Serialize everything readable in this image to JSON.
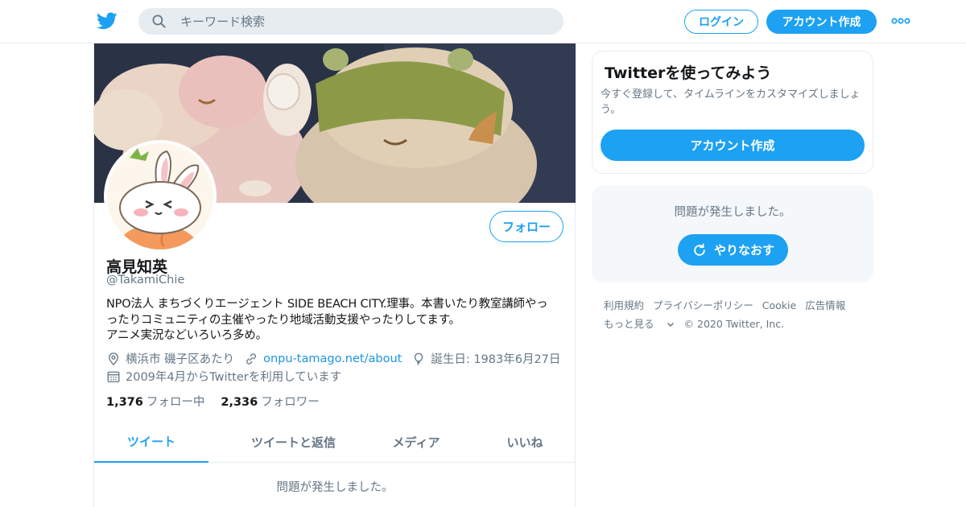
{
  "topbar": {
    "search_placeholder": "キーワード検索",
    "login_label": "ログイン",
    "signup_label": "アカウント作成"
  },
  "profile": {
    "name": "高見知英",
    "handle": "@TakamiChie",
    "bio_lines": [
      "NPO法人 まちづくりエージェント SIDE BEACH CITY.理事。本書いたり教室講師やっ",
      "ったりコミュニティの主催やったり地域活動支援やったりしてます。",
      "アニメ実況などいろいろ多め。"
    ],
    "location": "横浜市 磯子区あたり",
    "website": "onpu-tamago.net/about",
    "birthday": "誕生日: 1983年6月27日",
    "joined": "2009年4月からTwitterを利用しています",
    "following_count": "1,376",
    "following_label": "フォロー中",
    "followers_count": "2,336",
    "followers_label": "フォロワー",
    "follow_button": "フォロー"
  },
  "tabs": [
    {
      "label": "ツイート",
      "active": true
    },
    {
      "label": "ツイートと返信",
      "active": false
    },
    {
      "label": "メディア",
      "active": false
    },
    {
      "label": "いいね",
      "active": false
    }
  ],
  "tab_error": "問題が発生しました。",
  "signup_card": {
    "title": "Twitterを使ってみよう",
    "description": "今すぐ登録して、タイムラインをカスタマイズしましょう。",
    "button": "アカウント作成"
  },
  "error_card": {
    "message": "問題が発生しました。",
    "retry_label": "やりなおす"
  },
  "footer": {
    "links": [
      "利用規約",
      "プライバシーポリシー",
      "Cookie",
      "広告情報"
    ],
    "more": "もっと見る",
    "copyright": "© 2020 Twitter, Inc."
  },
  "colors": {
    "accent": "#1da1f2",
    "secondary_text": "#657786",
    "border": "#e6ecf0"
  },
  "icons": [
    "twitter-bird-icon",
    "search-icon",
    "more-icon",
    "location-icon",
    "link-icon",
    "balloon-icon",
    "calendar-icon",
    "refresh-icon",
    "chevron-down-icon"
  ]
}
